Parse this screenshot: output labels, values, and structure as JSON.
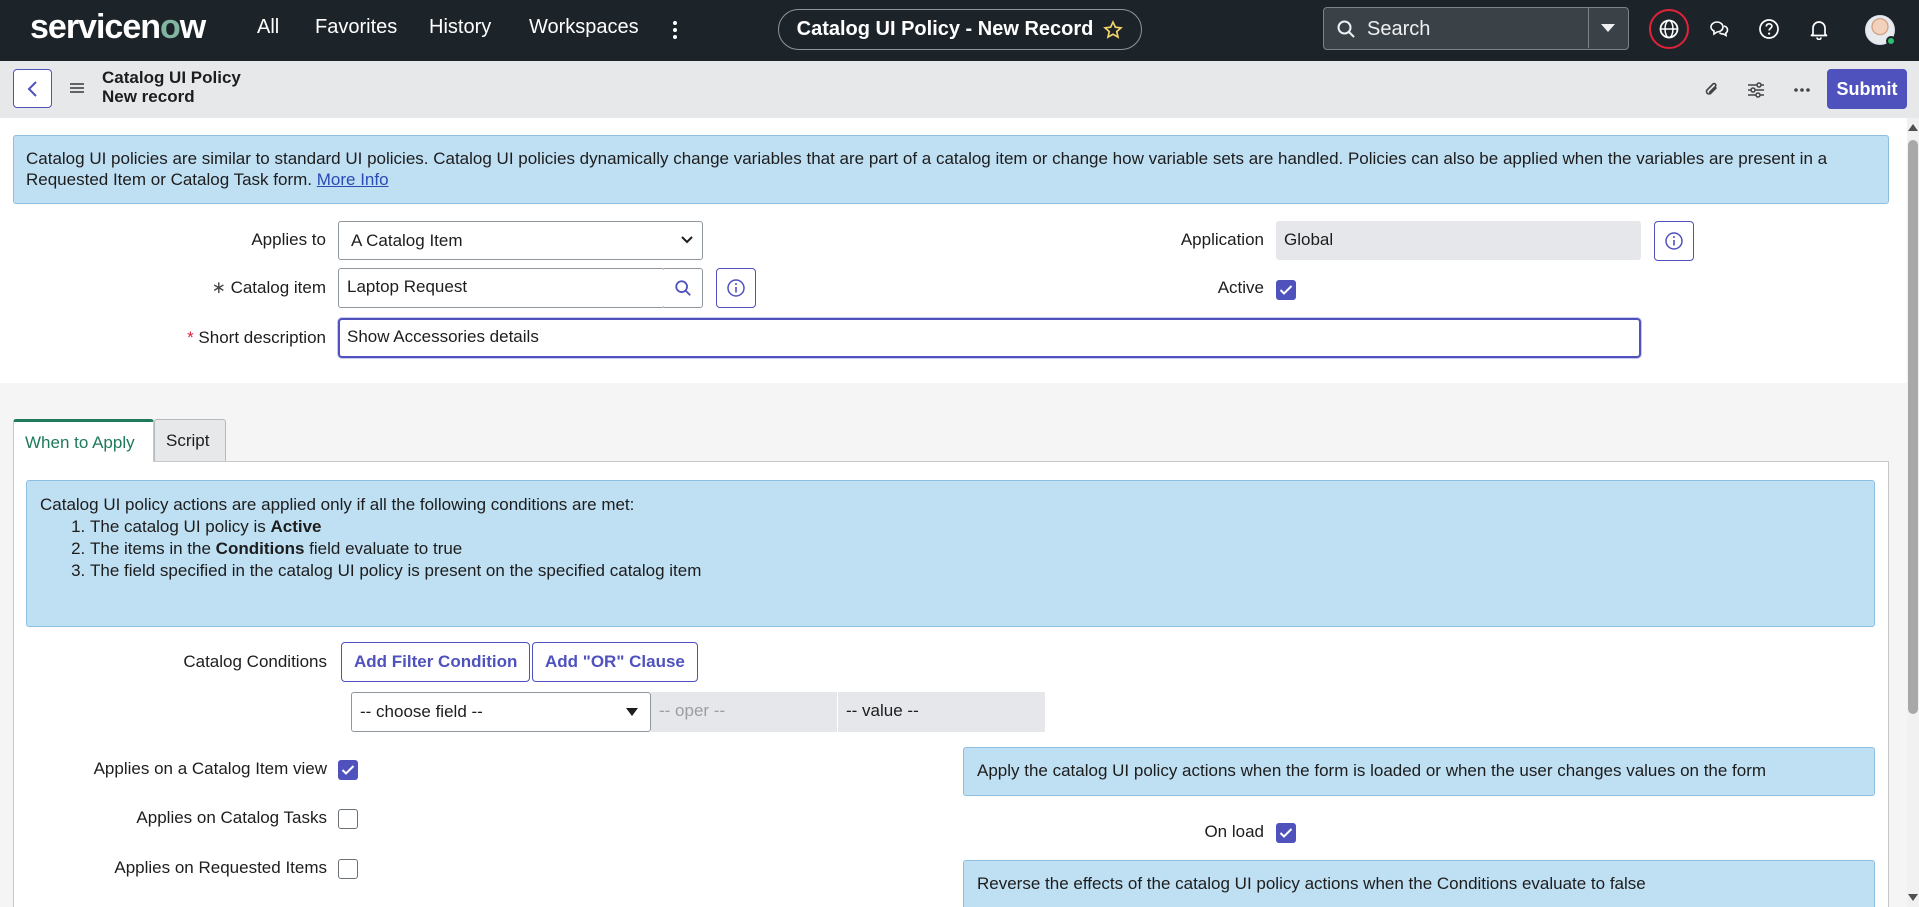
{
  "nav": {
    "logo_a": "servicen",
    "logo_o": "o",
    "logo_b": "w",
    "items": [
      "All",
      "Favorites",
      "History",
      "Workspaces"
    ],
    "record_title": "Catalog UI Policy - New Record",
    "search_placeholder": "Search"
  },
  "header": {
    "title_line1": "Catalog UI Policy",
    "title_line2": "New record",
    "submit_label": "Submit"
  },
  "info_banner": {
    "text": "Catalog UI policies are similar to standard UI policies. Catalog UI policies dynamically change variables that are part of a catalog item or change how variable sets are handled. Policies can also be applied when the variables are present in a Requested Item or Catalog Task form.",
    "link": "More Info"
  },
  "form": {
    "applies_to_label": "Applies to",
    "applies_to_value": "A Catalog Item",
    "catalog_item_label": "Catalog item",
    "catalog_item_value": "Laptop Request",
    "short_desc_label": "Short description",
    "short_desc_value": "Show Accessories details",
    "application_label": "Application",
    "application_value": "Global",
    "active_label": "Active",
    "active_checked": true,
    "required_marker": "*"
  },
  "tabs": [
    "When to Apply",
    "Script"
  ],
  "conditions_banner": {
    "intro": "Catalog UI policy actions are applied only if all the following conditions are met:",
    "item1_pre": "The catalog UI policy is ",
    "item1_bold": "Active",
    "item2_pre": "The items in the ",
    "item2_bold": "Conditions",
    "item2_post": " field evaluate to true",
    "item3": "The field specified in the catalog UI policy is present on the specified catalog item"
  },
  "conditions": {
    "label": "Catalog Conditions",
    "add_filter": "Add Filter Condition",
    "add_or": "Add \"OR\" Clause",
    "choose_field": "-- choose field --",
    "oper": "-- oper --",
    "value": "-- value --"
  },
  "applies_on": {
    "catalog_item_view": {
      "label": "Applies on a Catalog Item view",
      "checked": true
    },
    "catalog_tasks": {
      "label": "Applies on Catalog Tasks",
      "checked": false
    },
    "requested_items": {
      "label": "Applies on Requested Items",
      "checked": false
    }
  },
  "onload": {
    "note": "Apply the catalog UI policy actions when the form is loaded or when the user changes values on the form",
    "label": "On load",
    "checked": true
  },
  "reverse_note": "Reverse the effects of the catalog UI policy actions when the Conditions evaluate to false",
  "colors": {
    "nav_bg": "#1c2329",
    "accent": "#4f52bd",
    "banner_bg": "#bfdff3",
    "active_tab": "#1f7a5b",
    "required": "#e0223a"
  }
}
